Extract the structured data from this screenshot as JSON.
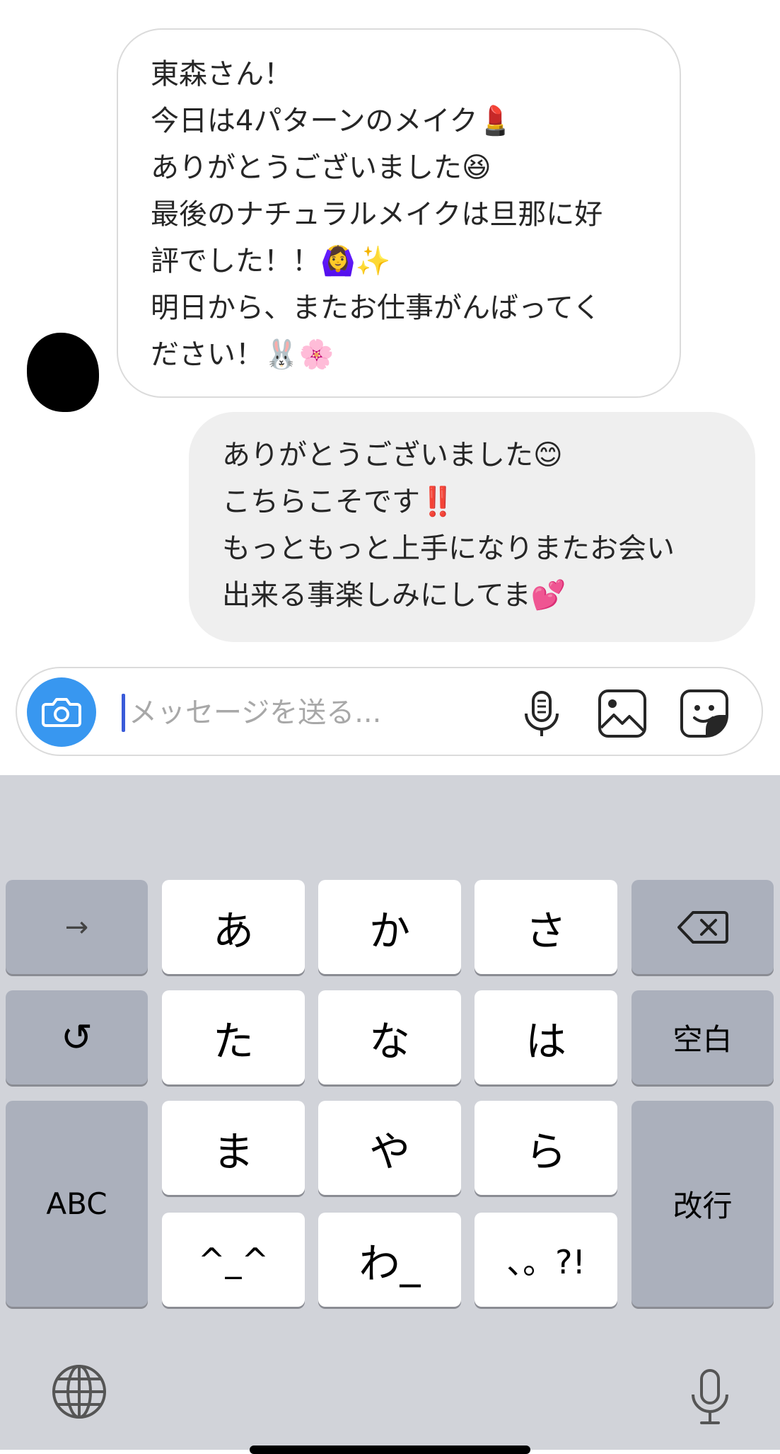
{
  "conversation": {
    "incoming": {
      "lines": [
        "東森さん！",
        "今日は4パターンのメイク💄",
        "ありがとうございました😆",
        "最後のナチュラルメイクは旦那に好",
        "評でした！！🙆‍♀️✨",
        "明日から、またお仕事がんばってく",
        "ださい！🐰🌸"
      ]
    },
    "outgoing": {
      "lines": [
        "ありがとうございました😊",
        "こちらこそです‼️",
        "もっともっと上手になりまたお会い",
        "出来る事楽しみにしてま💕"
      ]
    }
  },
  "composer": {
    "placeholder": "メッセージを送る...",
    "icons": {
      "camera": "camera-icon",
      "mic": "microphone-icon",
      "photo": "photo-gallery-icon",
      "sticker": "sticker-icon"
    },
    "accent_color": "#3897f0"
  },
  "keyboard": {
    "keys": {
      "arrow": "→",
      "a": "あ",
      "ka": "か",
      "sa": "さ",
      "undo": "↺",
      "ta": "た",
      "na": "な",
      "ha": "は",
      "space": "空白",
      "abc": "ABC",
      "ma": "ま",
      "ya": "や",
      "ra": "ら",
      "return": "改行",
      "kaomoji": "^_^",
      "wa": "わ_",
      "punct": "、。?!"
    },
    "icons": {
      "delete": "backspace-icon",
      "globe": "globe-icon",
      "dictation": "microphone-icon"
    }
  }
}
